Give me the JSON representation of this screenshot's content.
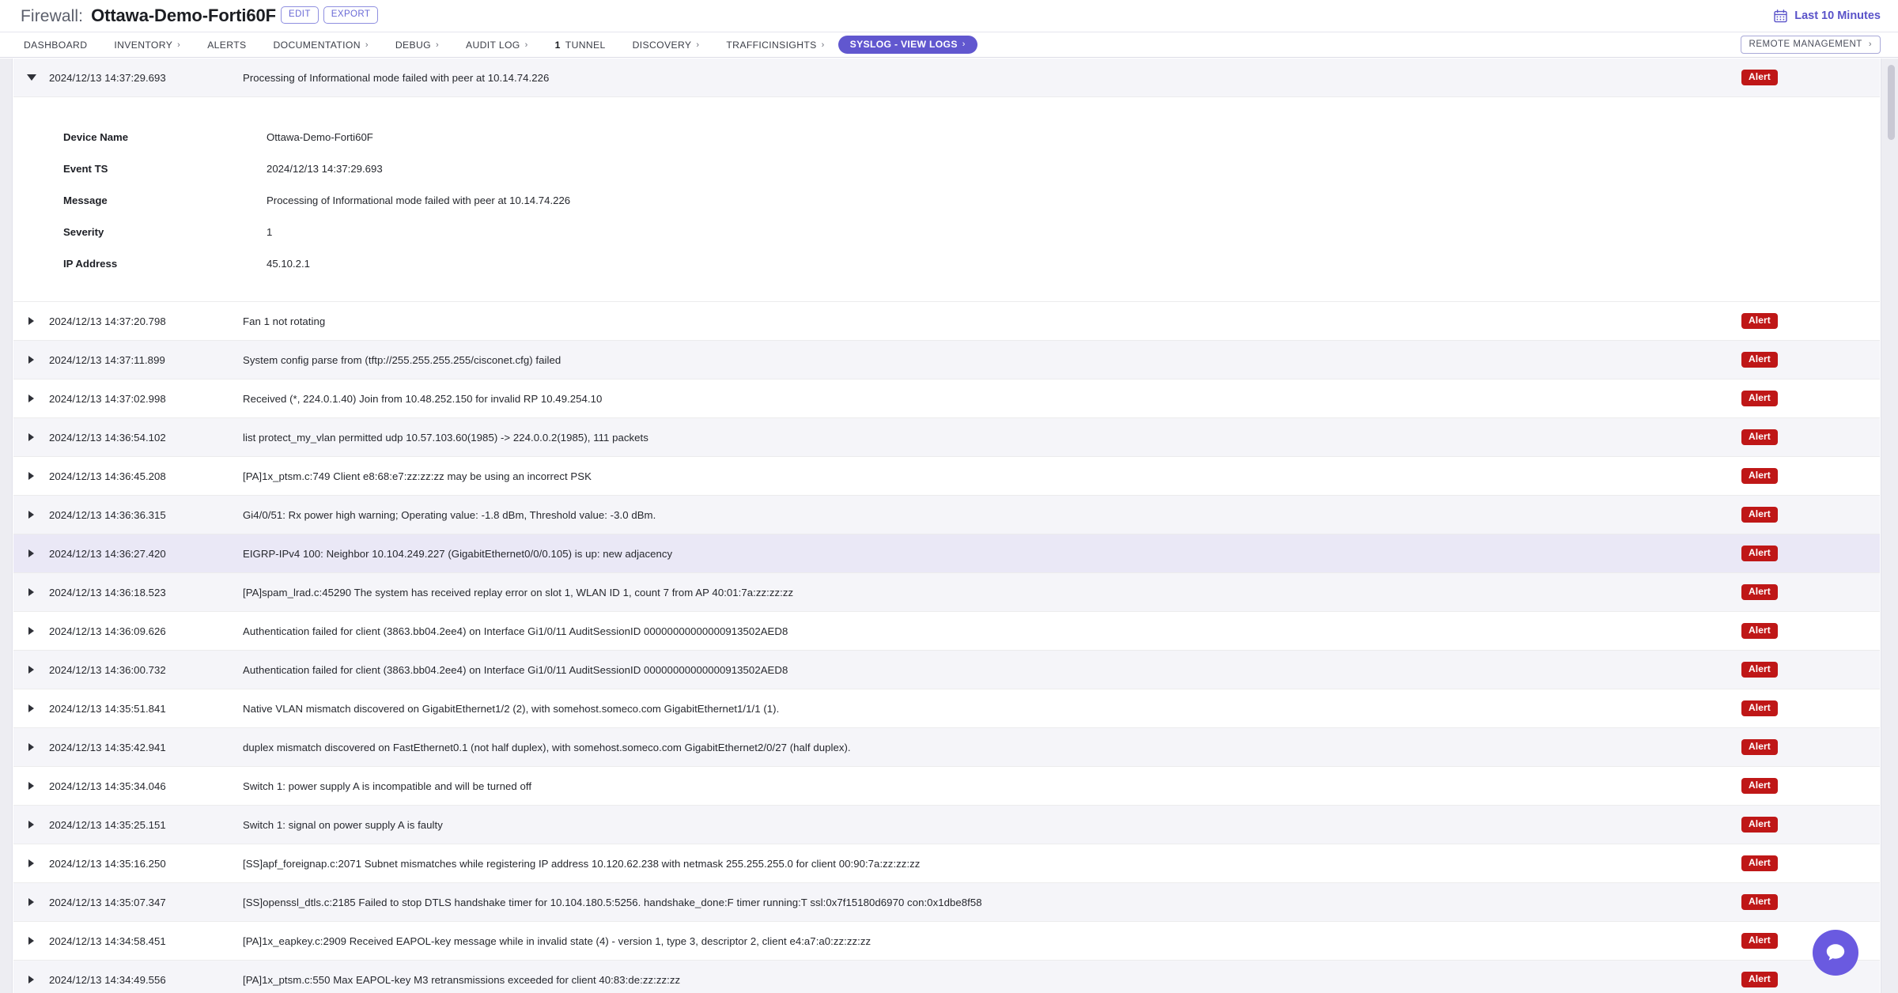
{
  "header": {
    "title_prefix": "Firewall:",
    "device_name": "Ottawa-Demo-Forti60F",
    "edit_label": "EDIT",
    "export_label": "EXPORT",
    "time_range_label": "Last 10 Minutes",
    "calendar_icon": "calendar-icon"
  },
  "nav": {
    "items": [
      {
        "label": "DASHBOARD",
        "chevron": false,
        "active": false,
        "pill": false
      },
      {
        "label": "INVENTORY",
        "chevron": true,
        "active": false,
        "pill": false
      },
      {
        "label": "ALERTS",
        "chevron": false,
        "active": false,
        "pill": false
      },
      {
        "label": "DOCUMENTATION",
        "chevron": true,
        "active": false,
        "pill": false
      },
      {
        "label": "DEBUG",
        "chevron": true,
        "active": false,
        "pill": false
      },
      {
        "label": "AUDIT LOG",
        "chevron": true,
        "active": false,
        "pill": false
      },
      {
        "label": "TUNNEL",
        "count": "1",
        "chevron": false,
        "active": false,
        "pill": false
      },
      {
        "label": "DISCOVERY",
        "chevron": true,
        "active": false,
        "pill": false
      },
      {
        "label": "TRAFFICINSIGHTS",
        "chevron": true,
        "active": false,
        "pill": false
      },
      {
        "label": "SYSLOG - VIEW LOGS",
        "chevron": true,
        "active": true,
        "pill": true
      }
    ],
    "remote_management_label": "REMOTE MANAGEMENT"
  },
  "colors": {
    "accent_purple": "#6157cf",
    "alert_red": "#bf1717",
    "row_alt": "#f5f5f9",
    "row_selected": "#eae8f6",
    "chat_fab": "#6a5ae0"
  },
  "expanded_detail": {
    "fields": [
      {
        "label": "Device Name",
        "value": "Ottawa-Demo-Forti60F"
      },
      {
        "label": "Event TS",
        "value": "2024/12/13 14:37:29.693"
      },
      {
        "label": "Message",
        "value": "Processing of Informational mode failed with peer at 10.14.74.226"
      },
      {
        "label": "Severity",
        "value": "1"
      },
      {
        "label": "IP Address",
        "value": "45.10.2.1"
      }
    ]
  },
  "log_rows": [
    {
      "timestamp": "2024/12/13 14:37:29.693",
      "message": "Processing of Informational mode failed with peer at 10.14.74.226",
      "badge": "Alert",
      "expanded": true,
      "shade": "alt"
    },
    {
      "timestamp": "2024/12/13 14:37:20.798",
      "message": "Fan 1 not rotating",
      "badge": "Alert",
      "expanded": false,
      "shade": "white"
    },
    {
      "timestamp": "2024/12/13 14:37:11.899",
      "message": "System config parse from (tftp://255.255.255.255/cisconet.cfg) failed",
      "badge": "Alert",
      "expanded": false,
      "shade": "alt"
    },
    {
      "timestamp": "2024/12/13 14:37:02.998",
      "message": "Received (*, 224.0.1.40) Join from 10.48.252.150 for invalid RP 10.49.254.10",
      "badge": "Alert",
      "expanded": false,
      "shade": "white"
    },
    {
      "timestamp": "2024/12/13 14:36:54.102",
      "message": "list protect_my_vlan permitted udp 10.57.103.60(1985) -> 224.0.0.2(1985), 111 packets",
      "badge": "Alert",
      "expanded": false,
      "shade": "alt"
    },
    {
      "timestamp": "2024/12/13 14:36:45.208",
      "message": "[PA]1x_ptsm.c:749 Client e8:68:e7:zz:zz:zz may be using an incorrect PSK",
      "badge": "Alert",
      "expanded": false,
      "shade": "white"
    },
    {
      "timestamp": "2024/12/13 14:36:36.315",
      "message": "Gi4/0/51: Rx power high warning; Operating value: -1.8 dBm, Threshold value: -3.0 dBm.",
      "badge": "Alert",
      "expanded": false,
      "shade": "alt"
    },
    {
      "timestamp": "2024/12/13 14:36:27.420",
      "message": "EIGRP-IPv4 100: Neighbor 10.104.249.227 (GigabitEthernet0/0/0.105) is up: new adjacency",
      "badge": "Alert",
      "expanded": false,
      "shade": "sel"
    },
    {
      "timestamp": "2024/12/13 14:36:18.523",
      "message": "[PA]spam_lrad.c:45290 The system has received replay error on slot 1, WLAN ID 1, count 7 from AP 40:01:7a:zz:zz:zz",
      "badge": "Alert",
      "expanded": false,
      "shade": "alt"
    },
    {
      "timestamp": "2024/12/13 14:36:09.626",
      "message": "Authentication failed for client (3863.bb04.2ee4) on Interface Gi1/0/11 AuditSessionID 00000000000000913502AED8",
      "badge": "Alert",
      "expanded": false,
      "shade": "white"
    },
    {
      "timestamp": "2024/12/13 14:36:00.732",
      "message": "Authentication failed for client (3863.bb04.2ee4) on Interface Gi1/0/11 AuditSessionID 00000000000000913502AED8",
      "badge": "Alert",
      "expanded": false,
      "shade": "alt"
    },
    {
      "timestamp": "2024/12/13 14:35:51.841",
      "message": "Native VLAN mismatch discovered on GigabitEthernet1/2 (2), with somehost.someco.com GigabitEthernet1/1/1 (1).",
      "badge": "Alert",
      "expanded": false,
      "shade": "white"
    },
    {
      "timestamp": "2024/12/13 14:35:42.941",
      "message": "duplex mismatch discovered on FastEthernet0.1 (not half duplex), with somehost.someco.com GigabitEthernet2/0/27 (half duplex).",
      "badge": "Alert",
      "expanded": false,
      "shade": "alt"
    },
    {
      "timestamp": "2024/12/13 14:35:34.046",
      "message": "Switch 1: power supply A is incompatible and will be turned off",
      "badge": "Alert",
      "expanded": false,
      "shade": "white"
    },
    {
      "timestamp": "2024/12/13 14:35:25.151",
      "message": "Switch 1: signal on power supply A is faulty",
      "badge": "Alert",
      "expanded": false,
      "shade": "alt"
    },
    {
      "timestamp": "2024/12/13 14:35:16.250",
      "message": "[SS]apf_foreignap.c:2071 Subnet mismatches while registering IP address 10.120.62.238 with netmask 255.255.255.0 for client 00:90:7a:zz:zz:zz",
      "badge": "Alert",
      "expanded": false,
      "shade": "white"
    },
    {
      "timestamp": "2024/12/13 14:35:07.347",
      "message": "[SS]openssl_dtls.c:2185 Failed to stop DTLS handshake timer for 10.104.180.5:5256. handshake_done:F timer running:T ssl:0x7f15180d6970 con:0x1dbe8f58",
      "badge": "Alert",
      "expanded": false,
      "shade": "alt"
    },
    {
      "timestamp": "2024/12/13 14:34:58.451",
      "message": "[PA]1x_eapkey.c:2909 Received EAPOL-key message while in invalid state (4) - version 1, type 3, descriptor 2, client e4:a7:a0:zz:zz:zz",
      "badge": "Alert",
      "expanded": false,
      "shade": "white"
    },
    {
      "timestamp": "2024/12/13 14:34:49.556",
      "message": "[PA]1x_ptsm.c:550 Max EAPOL-key M3 retransmissions exceeded for client 40:83:de:zz:zz:zz",
      "badge": "Alert",
      "expanded": false,
      "shade": "alt"
    }
  ],
  "chat": {
    "icon": "chat-bubble-icon"
  }
}
